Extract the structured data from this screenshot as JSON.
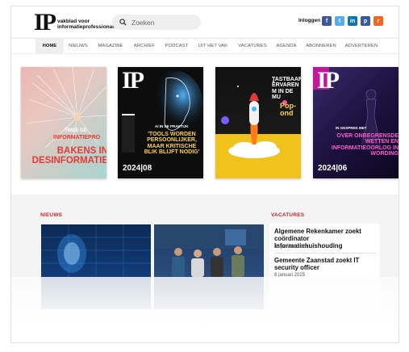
{
  "header": {
    "logo_mark": "IP",
    "logo_text": "vakblad voor informatieprofessionals",
    "search_placeholder": "Zoeken",
    "login_label": "Inloggen",
    "social": [
      {
        "icon": "facebook-icon",
        "glyph": "f",
        "color": "#3b5998"
      },
      {
        "icon": "twitter-icon",
        "glyph": "t",
        "color": "#55acee"
      },
      {
        "icon": "linkedin-icon",
        "glyph": "in",
        "color": "#0e76a8"
      },
      {
        "icon": "pinterest-icon",
        "glyph": "p",
        "color": "#3a5a99"
      },
      {
        "icon": "rss-icon",
        "glyph": "r",
        "color": "#f26522"
      }
    ]
  },
  "nav": {
    "items": [
      "HOME",
      "NIEUWS",
      "MAGAZINE",
      "ARCHIEF",
      "PODCAST",
      "UIT HET VAK",
      "VACATURES",
      "AGENDA",
      "ABONNEREN",
      "ADVERTEREN"
    ],
    "active": "HOME"
  },
  "covers": {
    "c1_line1": "TWEE GE",
    "c1_line2": "INFORMATIEPRO",
    "c1_title": "BAKENS IN DESINFORMATIE",
    "c2_mark": "IP",
    "c2_kicker": "AI IN DE PRAKTIJK",
    "c2_title": "'TOOLS WORDEN PERSOONLIJKER, MAAR KRITISCHE BLIK BLIJFT NODIG'",
    "c2_issue": "2024|08",
    "c3_title": "TASTBAAR ERVAREN M IN DE MU",
    "c3_sub": "Pop- ond",
    "c4_mark": "IP",
    "c4_kicker": "IN GESPREK MET",
    "c4_title": "OVER ONBEGRENSDE WETTEN EN INFORMATIEOORLOG IN WORDING",
    "c4_issue": "2024|06"
  },
  "news": {
    "heading": "NIEUWS"
  },
  "vacatures": {
    "heading": "VACATURES",
    "items": [
      {
        "title": "Algemene Rekenkamer zoekt coördinator Informatiehuishouding",
        "date": "15 januari 2025"
      },
      {
        "title": "Gemeente Zaanstad zoekt IT security officer",
        "date": "8 januari 2025"
      }
    ]
  },
  "colors": {
    "accent": "#c62828"
  }
}
